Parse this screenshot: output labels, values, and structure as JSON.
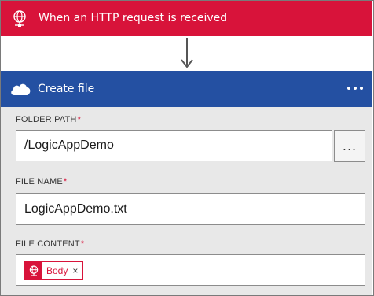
{
  "trigger": {
    "title": "When an HTTP request is received",
    "icon": "globe-network-icon",
    "color": "#d8133a"
  },
  "connector": {
    "icon": "arrow-down-icon"
  },
  "action": {
    "title": "Create file",
    "icon": "onedrive-cloud-icon",
    "header_color": "#2450a2",
    "more_icon": "more-options-icon",
    "fields": {
      "folder_path": {
        "label": "FOLDER PATH",
        "required_mark": "*",
        "value": "/LogicAppDemo",
        "browse_label": "..."
      },
      "file_name": {
        "label": "FILE NAME",
        "required_mark": "*",
        "value": "LogicAppDemo.txt"
      },
      "file_content": {
        "label": "FILE CONTENT",
        "required_mark": "*",
        "token": {
          "label": "Body",
          "icon": "globe-network-icon",
          "remove_label": "×"
        }
      }
    }
  }
}
